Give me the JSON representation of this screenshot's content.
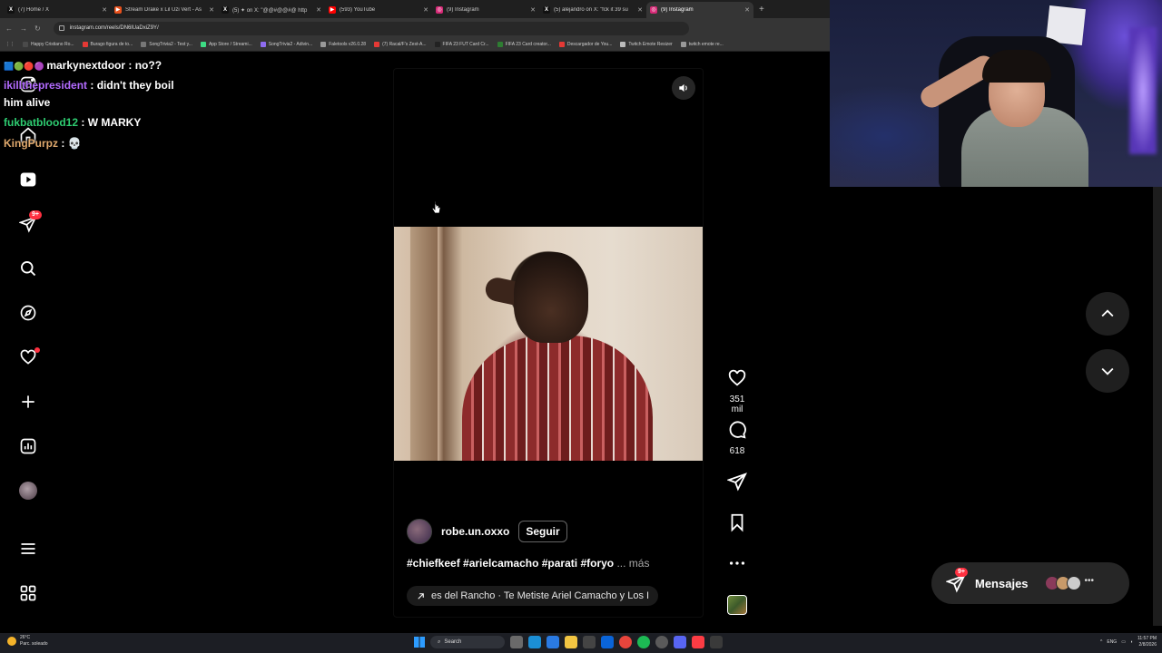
{
  "browser": {
    "tabs": [
      {
        "title": "(7) Home / X",
        "color": "#111111",
        "glyph": "X"
      },
      {
        "title": "Stream Drake x Lil Uzi Vert - As",
        "color": "#e8501b",
        "glyph": "▶"
      },
      {
        "title": "(5) ✦ on X: \"@@#@@#@ http",
        "color": "#111111",
        "glyph": "X"
      },
      {
        "title": "(593) YouTube",
        "color": "#ff0000",
        "glyph": "▶"
      },
      {
        "title": "(9) Instagram",
        "color": "#d62976",
        "glyph": "◎"
      },
      {
        "title": "(5) alejandro on X: \"fck it 39 su",
        "color": "#111111",
        "glyph": "X"
      },
      {
        "title": "(9) Instagram",
        "color": "#d62976",
        "glyph": "◎",
        "active": true
      }
    ],
    "new_tab": "+",
    "url": "instagram.com/reels/DN6lUaDxiZ9Y/",
    "bookmarks": [
      {
        "label": "Happy Cristiano Ro...",
        "color": "#4a4a4a"
      },
      {
        "label": "Burago figura de to...",
        "color": "#e53935"
      },
      {
        "label": "SongTrivia2 - Test y...",
        "color": "#777777"
      },
      {
        "label": "App Store / Streami...",
        "color": "#3ddc84"
      },
      {
        "label": "SongTrivia2 - Adivin...",
        "color": "#8e6cf0"
      },
      {
        "label": "Faletools v26.0.28",
        "color": "#999999"
      },
      {
        "label": "(7) Racal/F's Zest-A...",
        "color": "#e53935"
      },
      {
        "label": "FIFA 23 FUT Card Cr...",
        "color": "#222222"
      },
      {
        "label": "FIFA 23 Card creator...",
        "color": "#2e7d32"
      },
      {
        "label": "Descargador de You...",
        "color": "#e53935"
      },
      {
        "label": "Twitch Emote Resizer",
        "color": "#bbbbbb"
      },
      {
        "label": "twitch emote re...",
        "color": "#999999"
      }
    ]
  },
  "chat": [
    {
      "user": "markynextdoor",
      "text": "no??",
      "color": "#ffffff"
    },
    {
      "user": "ikillthepresident",
      "text": "didn't they boil",
      "text2": "him alive",
      "color": "#b36bff"
    },
    {
      "user": "fukbatblood12",
      "text": "W MARKY",
      "color": "#2ecc71"
    },
    {
      "user": "KingPurpz",
      "text": "💀",
      "color": "#e0a96d"
    }
  ],
  "sidebar": {
    "notifications_badge": "9+"
  },
  "reel": {
    "username": "robe.un.oxxo",
    "follow_label": "Seguir",
    "caption": "#chiefkeef #arielcamacho #parati #foryo",
    "more_label": "... más",
    "audio": "es del Rancho · Te Metiste   Ariel Camacho y Los I",
    "likes": "351 mil",
    "comments": "618"
  },
  "messages": {
    "label": "Mensajes",
    "badge": "9+"
  },
  "taskbar": {
    "temp": "26°C",
    "weather": "Parc. soleado",
    "search": "Search",
    "lang": "ENG",
    "time": "11:57 PM",
    "date": "2/8/2026"
  },
  "colors": {
    "accent_red": "#ff3040",
    "panel": "#262626"
  }
}
